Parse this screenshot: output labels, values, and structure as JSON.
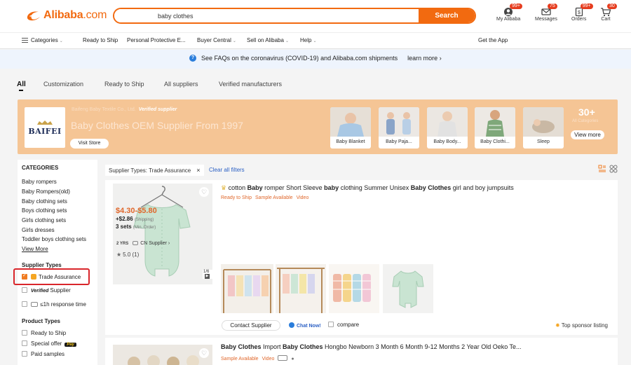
{
  "header": {
    "logo_text": "Alibaba",
    "logo_suffix": ".com",
    "search_value": "baby clothes",
    "search_button": "Search",
    "actions": [
      {
        "label": "My Alibaba",
        "badge": "99+",
        "icon": "user-icon"
      },
      {
        "label": "Messages",
        "badge": "75",
        "icon": "message-icon"
      },
      {
        "label": "Orders",
        "badge": "99+",
        "icon": "orders-icon"
      },
      {
        "label": "Cart",
        "badge": "30",
        "icon": "cart-icon"
      }
    ]
  },
  "nav": {
    "categories": "Categories",
    "items": [
      "Ready to Ship",
      "Personal Protective E...",
      "Buyer Central",
      "Sell on Alibaba",
      "Help"
    ],
    "get_app": "Get the App"
  },
  "notice": {
    "text": "See FAQs on the coronavirus (COVID-19) and Alibaba.com shipments",
    "link": "learn more"
  },
  "tabs": [
    "All",
    "Customization",
    "Ready to Ship",
    "All suppliers",
    "Verified manufacturers"
  ],
  "banner": {
    "brand": "BAIFEI",
    "supplier_line": "Baifeng Baby Textile Co., Ltd.",
    "verified": "Verified supplier",
    "title": "Baby Clothes OEM Supplier From 1997",
    "visit": "Visit Store",
    "categories": [
      "Baby Blanket",
      "Baby Paja...",
      "Baby Body...",
      "Baby Clothi...",
      "Sleep"
    ],
    "more_count": "30+",
    "more_sub": "All Categories",
    "view_more": "View more"
  },
  "sidebar": {
    "categories_title": "CATEGORIES",
    "categories": [
      "Baby rompers",
      "Baby Rompers(old)",
      "Baby clothing sets",
      "Boys clothing sets",
      "Girls clothing sets",
      "Girls dresses",
      "Toddler boys clothing sets"
    ],
    "view_more": "View More",
    "supplier_types_title": "Supplier Types",
    "trade_assurance": "Trade Assurance",
    "verified_tag": "Verified",
    "verified_supplier": "Supplier",
    "response_time": "≤1h response time",
    "product_types_title": "Product Types",
    "product_types": [
      "Ready to Ship",
      "Special offer",
      "Paid samples"
    ],
    "pay_tag": "Pay"
  },
  "filters": {
    "chip": "Supplier Types: Trade Assurance",
    "close": "×",
    "clear": "Clear all filters"
  },
  "product1": {
    "title_parts": [
      "cotton ",
      "Baby",
      " romper Short Sleeve ",
      "baby",
      " clothing Summer Unisex ",
      "Baby Clothes",
      " girl and boy jumpsuits"
    ],
    "tags": [
      "Ready to Ship",
      "Sample Available",
      "Video"
    ],
    "price": "$4.30-$5.80",
    "shipping": "+$2.86",
    "shipping_note": "(Shipping)",
    "moq": "3 sets",
    "moq_note": "(Min. Order)",
    "years": "2 YRS",
    "country": "CN",
    "supplier": "Supplier",
    "rating": "5.0 (1)",
    "pager": "1/6",
    "contact": "Contact Supplier",
    "chat": "Chat Now!",
    "compare": "compare",
    "sponsor": "Top sponsor listing"
  },
  "product2": {
    "title_parts": [
      "Baby Clothes",
      " Import ",
      "Baby Clothes",
      " Hongbo Newborn 3 Month 6 Month 9-12 Months 2 Year Old Oeko Te..."
    ],
    "tags": [
      "Sample Available",
      "Video"
    ]
  },
  "colors": {
    "brand_orange": "#f26a10",
    "price_orange": "#e0672b",
    "banner_bg": "#f5c595",
    "highlight_red": "#d9262b"
  }
}
